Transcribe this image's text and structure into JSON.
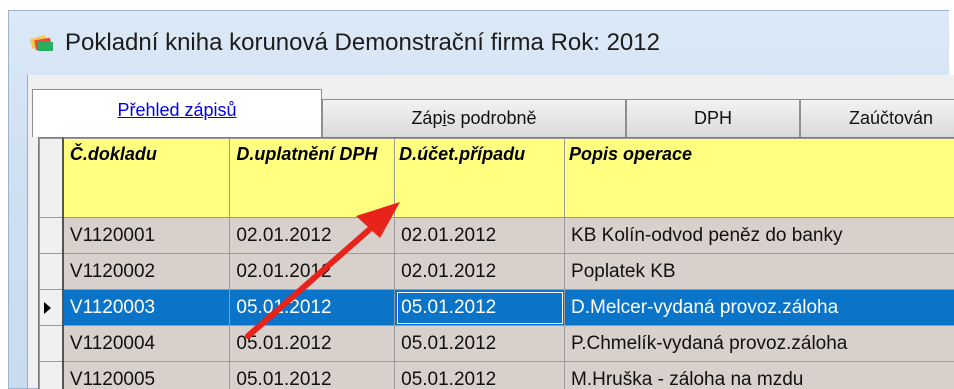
{
  "window": {
    "title": "Pokladní kniha korunová  Demonstrační firma  Rok: 2012"
  },
  "tabs": [
    {
      "label": "Přehled zápisů",
      "active": true
    },
    {
      "label_pre": "Záp",
      "label_ul": "i",
      "label_post": "s podrobně",
      "active": false
    },
    {
      "label": "DPH",
      "active": false
    },
    {
      "label": "Zaúčtován",
      "active": false
    }
  ],
  "grid": {
    "columns": [
      "Č.dokladu",
      "D.uplatnění DPH",
      "D.účet.případu",
      "Popis operace"
    ],
    "rows": [
      {
        "doc": "V1120001",
        "dph": "02.01.2012",
        "ucet": "02.01.2012",
        "popis": "KB Kolín-odvod peněz do banky"
      },
      {
        "doc": "V1120002",
        "dph": "02.01.2012",
        "ucet": "02.01.2012",
        "popis": "Poplatek KB"
      },
      {
        "doc": "V1120003",
        "dph": "05.01.2012",
        "ucet": "05.01.2012",
        "popis": "D.Melcer-vydaná provoz.záloha"
      },
      {
        "doc": "V1120004",
        "dph": "05.01.2012",
        "ucet": "05.01.2012",
        "popis": "P.Chmelík-vydaná provoz.záloha"
      },
      {
        "doc": "V1120005",
        "dph": "05.01.2012",
        "ucet": "05.01.2012",
        "popis": "M.Hruška - záloha na mzdu"
      }
    ],
    "selected_row": 2
  },
  "colors": {
    "header_yellow": "#ffff80",
    "row_bg": "#d8d0cb",
    "selected": "#0a74c9",
    "annotation_arrow": "#e8231c"
  }
}
